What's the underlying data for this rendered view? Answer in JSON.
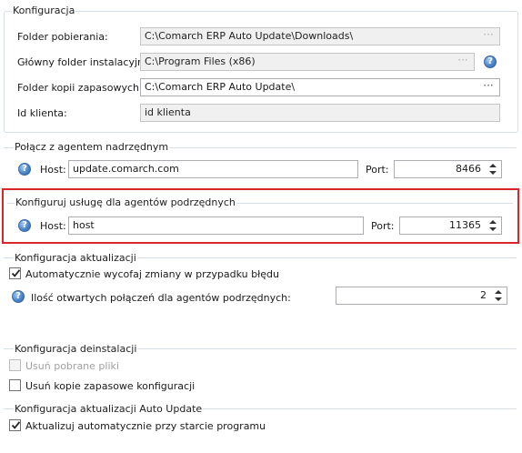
{
  "konfiguracja": {
    "legend": "Konfiguracja",
    "download_folder_label": "Folder pobierania:",
    "download_folder_value": "C:\\Comarch ERP Auto Update\\Downloads\\",
    "install_folder_label": "Główny folder instalacyjny:",
    "install_folder_value": "C:\\Program Files (x86)",
    "backup_folder_label": "Folder kopii zapasowych:",
    "backup_folder_value": "C:\\Comarch ERP Auto Update\\",
    "client_id_label": "Id klienta:",
    "client_id_value": "id klienta",
    "browse_glyph": "···"
  },
  "parent_agent": {
    "legend": "Połącz z agentem nadrzędnym",
    "host_label": "Host:",
    "host_value": "update.comarch.com",
    "port_label": "Port:",
    "port_value": "8466"
  },
  "child_agents": {
    "legend": "Konfiguruj usługę dla agentów podrzędnych",
    "host_label": "Host:",
    "host_value": "host",
    "port_label": "Port:",
    "port_value": "11365"
  },
  "update_config": {
    "legend": "Konfiguracja aktualizacji",
    "rollback_label": "Automatycznie wycofaj zmiany w przypadku błędu",
    "rollback_checked": true,
    "connections_label": "Ilość otwartych połączeń dla agentów podrzędnych:",
    "connections_value": "2"
  },
  "uninstall_config": {
    "legend": "Konfiguracja deinstalacji",
    "remove_downloaded_label": "Usuń pobrane pliki",
    "remove_downloaded_enabled": false,
    "remove_backups_label": "Usuń kopie zapasowe konfiguracji"
  },
  "autoupdate_config": {
    "legend": "Konfiguracja aktualizacji Auto Update",
    "auto_update_label": "Aktualizuj automatycznie przy starcie programu",
    "auto_update_checked": true
  },
  "icons": {
    "help": "help-icon",
    "check": "checkmark-icon",
    "spin_up": "arrow-up-icon",
    "spin_down": "arrow-down-icon"
  },
  "colors": {
    "highlight_border": "#d9262b",
    "group_border": "#d5dfe5",
    "readonly_bg": "#f0f0f0"
  }
}
